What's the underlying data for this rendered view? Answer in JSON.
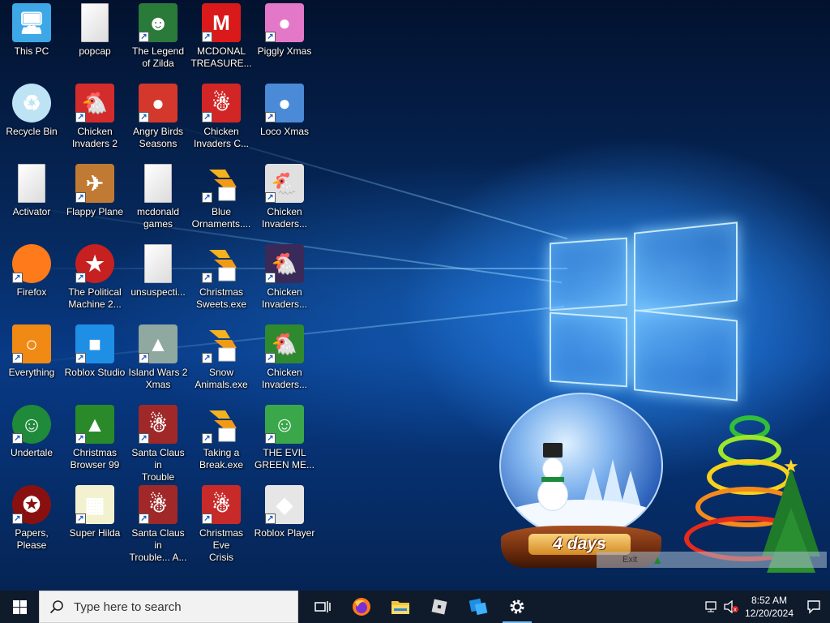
{
  "desktop": {
    "icons": [
      {
        "id": "this-pc",
        "label": "This PC",
        "shortcut": false,
        "icon": "computer-icon",
        "color": "#3ea7e6"
      },
      {
        "id": "recycle-bin",
        "label": "Recycle Bin",
        "shortcut": false,
        "icon": "recycle-bin-icon",
        "color": "#bde3f5"
      },
      {
        "id": "activator",
        "label": "Activator",
        "shortcut": false,
        "icon": "file-icon",
        "color": "#eeeeee"
      },
      {
        "id": "firefox",
        "label": "Firefox",
        "shortcut": true,
        "icon": "firefox-icon",
        "color": "#ff7a1a"
      },
      {
        "id": "everything",
        "label": "Everything",
        "shortcut": true,
        "icon": "magnifier-icon",
        "color": "#f08a14"
      },
      {
        "id": "undertale",
        "label": "Undertale",
        "shortcut": true,
        "icon": "undertale-icon",
        "color": "#1f8a3a"
      },
      {
        "id": "papers-please",
        "label": "Papers, Please",
        "shortcut": true,
        "icon": "papers-please-icon",
        "color": "#8a1010"
      },
      {
        "id": "popcap",
        "label": "popcap",
        "shortcut": false,
        "icon": "folder-icon",
        "color": "#e8d9a6"
      },
      {
        "id": "chicken-invaders-2",
        "label": "Chicken\nInvaders 2",
        "shortcut": true,
        "icon": "chicken-icon",
        "color": "#d42c2c"
      },
      {
        "id": "flappy-plane",
        "label": "Flappy Plane",
        "shortcut": true,
        "icon": "plane-icon",
        "color": "#c07a34"
      },
      {
        "id": "political-machine",
        "label": "The Political\nMachine 2...",
        "shortcut": true,
        "icon": "political-machine-icon",
        "color": "#c62020"
      },
      {
        "id": "roblox-studio",
        "label": "Roblox Studio",
        "shortcut": true,
        "icon": "roblox-studio-icon",
        "color": "#1f8fe6"
      },
      {
        "id": "christmas-browser-99",
        "label": "Christmas\nBrowser 99",
        "shortcut": true,
        "icon": "christmas-tree-icon",
        "color": "#2a8a2a"
      },
      {
        "id": "super-hilda",
        "label": "Super Hilda",
        "shortcut": true,
        "icon": "pixel-character-icon",
        "color": "#f2f2d0"
      },
      {
        "id": "legend-of-zilda",
        "label": "The Legend\nof Zilda",
        "shortcut": true,
        "icon": "zilda-icon",
        "color": "#2a7a3a"
      },
      {
        "id": "angry-birds-seasons",
        "label": "Angry Birds\nSeasons",
        "shortcut": true,
        "icon": "angry-bird-icon",
        "color": "#d4372c"
      },
      {
        "id": "mcdonald-games",
        "label": "mcdonald\ngames",
        "shortcut": false,
        "icon": "file-icon",
        "color": "#eeeeee"
      },
      {
        "id": "unsuspecting",
        "label": "unsuspecti...",
        "shortcut": false,
        "icon": "file-icon",
        "color": "#eeeeee"
      },
      {
        "id": "island-wars-2",
        "label": "Island Wars 2\nXmas",
        "shortcut": true,
        "icon": "island-icon",
        "color": "#8fa8a0"
      },
      {
        "id": "santa-claus-trouble",
        "label": "Santa Claus in\nTrouble",
        "shortcut": true,
        "icon": "santa-icon",
        "color": "#a02828"
      },
      {
        "id": "santa-claus-trouble-a",
        "label": "Santa Claus in\nTrouble... A...",
        "shortcut": true,
        "icon": "santa-icon",
        "color": "#a02828"
      },
      {
        "id": "mcdonal-treasure",
        "label": "MCDONAL\nTREASURE...",
        "shortcut": true,
        "icon": "mcdonalds-icon",
        "color": "#da1a1a"
      },
      {
        "id": "chicken-invaders-c",
        "label": "Chicken\nInvaders C...",
        "shortcut": true,
        "icon": "chicken-snowman-icon",
        "color": "#d22626"
      },
      {
        "id": "blue-ornaments",
        "label": "Blue\nOrnaments....",
        "shortcut": true,
        "icon": "app-exe-icon",
        "color": "#f5b21c"
      },
      {
        "id": "christmas-sweets",
        "label": "Christmas\nSweets.exe",
        "shortcut": true,
        "icon": "app-exe-icon",
        "color": "#f5b21c"
      },
      {
        "id": "snow-animals",
        "label": "Snow\nAnimals.exe",
        "shortcut": true,
        "icon": "app-exe-icon",
        "color": "#f5b21c"
      },
      {
        "id": "taking-a-break",
        "label": "Taking a\nBreak.exe",
        "shortcut": true,
        "icon": "app-exe-icon",
        "color": "#f5b21c"
      },
      {
        "id": "christmas-eve-crisis",
        "label": "Christmas Eve\nCrisis",
        "shortcut": true,
        "icon": "santa-icon",
        "color": "#c82a2a"
      },
      {
        "id": "piggly-xmas",
        "label": "Piggly Xmas",
        "shortcut": true,
        "icon": "pig-icon",
        "color": "#e478c8"
      },
      {
        "id": "loco-xmas",
        "label": "Loco Xmas",
        "shortcut": true,
        "icon": "teddy-bear-icon",
        "color": "#4a8ad6"
      },
      {
        "id": "chicken-invaders-a",
        "label": "Chicken\nInvaders...",
        "shortcut": true,
        "icon": "chicken-icon",
        "color": "#e0e0e0"
      },
      {
        "id": "chicken-invaders-b",
        "label": "Chicken\nInvaders...",
        "shortcut": true,
        "icon": "chicken-icon",
        "color": "#3a2a5a"
      },
      {
        "id": "chicken-invaders-d",
        "label": "Chicken\nInvaders...",
        "shortcut": true,
        "icon": "chicken-icon",
        "color": "#2f8a2f"
      },
      {
        "id": "evil-green-me",
        "label": "THE EVIL\nGREEN ME...",
        "shortcut": true,
        "icon": "messenger-icon",
        "color": "#3aa84a"
      },
      {
        "id": "roblox-player",
        "label": "Roblox Player",
        "shortcut": true,
        "icon": "roblox-icon",
        "color": "#e6e6e6"
      }
    ]
  },
  "widget": {
    "days_label": "4 days",
    "exit_label": "Exit"
  },
  "taskbar": {
    "search_placeholder": "Type here to search",
    "pinned": [
      {
        "id": "task-view",
        "icon": "task-view-icon"
      },
      {
        "id": "firefox",
        "icon": "firefox-icon"
      },
      {
        "id": "file-explorer",
        "icon": "folder-icon"
      },
      {
        "id": "roblox",
        "icon": "roblox-icon"
      },
      {
        "id": "roblox-studio",
        "icon": "roblox-studio-icon"
      },
      {
        "id": "settings",
        "icon": "gear-icon"
      }
    ],
    "clock": {
      "time": "8:52 AM",
      "date": "12/20/2024"
    }
  },
  "colors": {
    "taskbar": "#0f1a2b",
    "search_bg": "#f2f2f2",
    "accent": "#76b9ed"
  }
}
